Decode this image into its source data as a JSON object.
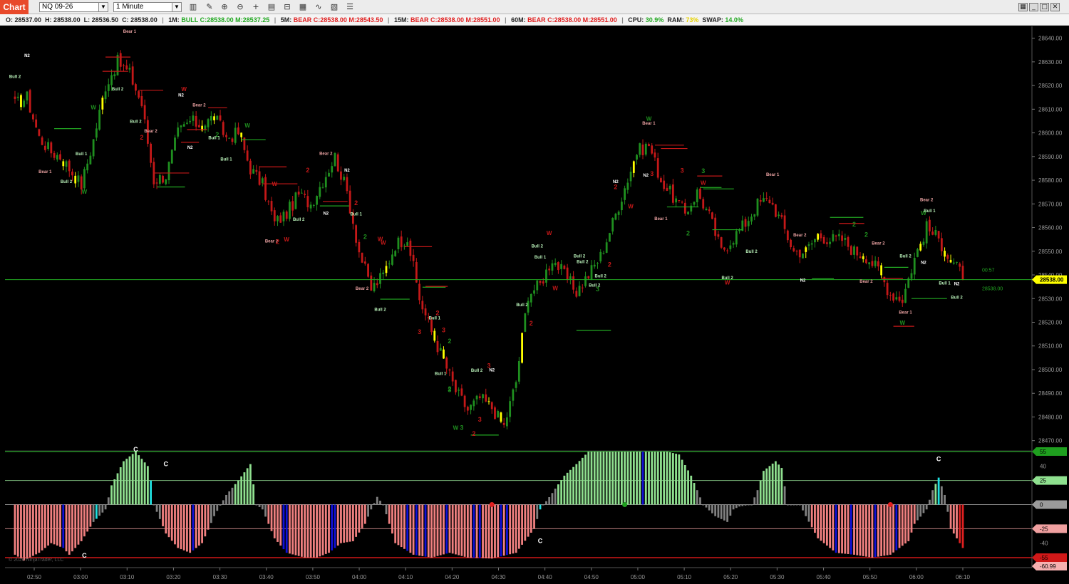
{
  "toolbar": {
    "tab_label": "Chart",
    "instrument": "NQ 09-26",
    "interval": "1 Minute"
  },
  "infobar": {
    "open": "O: 28537.00",
    "high": "H: 28538.00",
    "low": "L: 28536.50",
    "close": "C: 28538.00",
    "tf1_label": "1M:",
    "tf1_value": "BULL C:28538.00 M:28537.25",
    "tf5_label": "5M:",
    "tf5_value": "BEAR C:28538.00 M:28543.50",
    "tf15_label": "15M:",
    "tf15_value": "BEAR C:28538.00 M:28551.00",
    "tf60_label": "60M:",
    "tf60_value": "BEAR C:28538.00 M:28551.00",
    "cpu_label": "CPU:",
    "cpu_value": "30.9%",
    "ram_label": "RAM:",
    "ram_value": "73%",
    "swap_label": "SWAP:",
    "swap_value": "14.0%"
  },
  "colors": {
    "bull": "#1f8f1f",
    "bear": "#c41818",
    "doji": "#ffff00",
    "level_line": "#22a822",
    "osc_pos": "#8fe08f",
    "osc_neg": "#f08080",
    "osc_neutral": "#808080",
    "osc_blue": "#1010d8",
    "osc_cyan": "#20e0e0"
  },
  "chart_data": [
    {
      "type": "candlestick",
      "x_ticks": [
        "02:50",
        "03:00",
        "03:10",
        "03:20",
        "03:30",
        "03:40",
        "03:50",
        "04:00",
        "04:10",
        "04:20",
        "04:30",
        "04:40",
        "04:50",
        "05:00",
        "05:10",
        "05:20",
        "05:30",
        "05:40",
        "05:50",
        "06:00",
        "06:10"
      ],
      "y_ticks": [
        28470,
        28480,
        28490,
        28500,
        28510,
        28520,
        28530,
        28540,
        28550,
        28560,
        28570,
        28580,
        28590,
        28600,
        28610,
        28620,
        28630,
        28640
      ],
      "ylim": [
        28466,
        28645
      ],
      "last_price": "28538.00",
      "last_price_value": 28538,
      "timer": "00:57",
      "timer_price": "28538.00",
      "keypoints": [
        [
          0,
          28612
        ],
        [
          4,
          28615
        ],
        [
          8,
          28598
        ],
        [
          12,
          28592
        ],
        [
          15,
          28590
        ],
        [
          18,
          28585
        ],
        [
          22,
          28578
        ],
        [
          26,
          28597
        ],
        [
          30,
          28620
        ],
        [
          34,
          28630
        ],
        [
          38,
          28625
        ],
        [
          42,
          28612
        ],
        [
          46,
          28580
        ],
        [
          50,
          28582
        ],
        [
          54,
          28600
        ],
        [
          58,
          28605
        ],
        [
          62,
          28603
        ],
        [
          66,
          28607
        ],
        [
          70,
          28598
        ],
        [
          74,
          28600
        ],
        [
          78,
          28585
        ],
        [
          82,
          28578
        ],
        [
          86,
          28562
        ],
        [
          90,
          28566
        ],
        [
          94,
          28574
        ],
        [
          98,
          28570
        ],
        [
          102,
          28580
        ],
        [
          106,
          28590
        ],
        [
          110,
          28575
        ],
        [
          114,
          28550
        ],
        [
          118,
          28534
        ],
        [
          122,
          28540
        ],
        [
          126,
          28553
        ],
        [
          130,
          28556
        ],
        [
          134,
          28530
        ],
        [
          138,
          28516
        ],
        [
          142,
          28504
        ],
        [
          146,
          28491
        ],
        [
          150,
          28483
        ],
        [
          154,
          28488
        ],
        [
          158,
          28484
        ],
        [
          162,
          28476
        ],
        [
          166,
          28495
        ],
        [
          170,
          28532
        ],
        [
          174,
          28536
        ],
        [
          178,
          28547
        ],
        [
          182,
          28540
        ],
        [
          186,
          28533
        ],
        [
          190,
          28540
        ],
        [
          194,
          28548
        ],
        [
          198,
          28562
        ],
        [
          202,
          28577
        ],
        [
          206,
          28592
        ],
        [
          210,
          28595
        ],
        [
          214,
          28580
        ],
        [
          218,
          28573
        ],
        [
          222,
          28566
        ],
        [
          226,
          28575
        ],
        [
          230,
          28565
        ],
        [
          234,
          28550
        ],
        [
          238,
          28556
        ],
        [
          242,
          28562
        ],
        [
          246,
          28570
        ],
        [
          250,
          28572
        ],
        [
          254,
          28562
        ],
        [
          258,
          28550
        ],
        [
          262,
          28550
        ],
        [
          266,
          28557
        ],
        [
          270,
          28555
        ],
        [
          274,
          28555
        ],
        [
          278,
          28550
        ],
        [
          282,
          28548
        ],
        [
          286,
          28542
        ],
        [
          290,
          28532
        ],
        [
          294,
          28530
        ],
        [
          298,
          28547
        ],
        [
          302,
          28560
        ],
        [
          306,
          28555
        ],
        [
          310,
          28546
        ],
        [
          314,
          28540
        ]
      ]
    },
    {
      "type": "bar",
      "y_ticks": [
        55,
        40,
        25,
        0,
        -25,
        -40,
        -55,
        -60.99
      ],
      "ylim": [
        -58,
        58
      ],
      "levels": [
        55,
        25,
        0,
        -25,
        -55
      ],
      "last_value": "-60.99",
      "markers": [
        "C"
      ],
      "keypoints": [
        [
          0,
          -52
        ],
        [
          3,
          -58
        ],
        [
          8,
          -50
        ],
        [
          12,
          -40
        ],
        [
          16,
          -45
        ],
        [
          18,
          -52
        ],
        [
          22,
          -38
        ],
        [
          26,
          -18
        ],
        [
          30,
          -5
        ],
        [
          32,
          20
        ],
        [
          36,
          45
        ],
        [
          40,
          55
        ],
        [
          44,
          40
        ],
        [
          45,
          25
        ],
        [
          46,
          0
        ],
        [
          50,
          -30
        ],
        [
          54,
          -45
        ],
        [
          58,
          -50
        ],
        [
          62,
          -40
        ],
        [
          66,
          -12
        ],
        [
          70,
          10
        ],
        [
          74,
          25
        ],
        [
          78,
          42
        ],
        [
          80,
          0
        ],
        [
          82,
          -5
        ],
        [
          86,
          -35
        ],
        [
          90,
          -50
        ],
        [
          96,
          -55
        ],
        [
          100,
          -55
        ],
        [
          104,
          -50
        ],
        [
          108,
          -40
        ],
        [
          112,
          -38
        ],
        [
          116,
          -20
        ],
        [
          118,
          -5
        ],
        [
          120,
          8
        ],
        [
          122,
          0
        ],
        [
          126,
          -40
        ],
        [
          132,
          -52
        ],
        [
          138,
          -55
        ],
        [
          144,
          -50
        ],
        [
          150,
          -55
        ],
        [
          158,
          -56
        ],
        [
          166,
          -50
        ],
        [
          172,
          -25
        ],
        [
          174,
          -5
        ],
        [
          178,
          12
        ],
        [
          182,
          30
        ],
        [
          186,
          42
        ],
        [
          190,
          55
        ],
        [
          200,
          55
        ],
        [
          208,
          55
        ],
        [
          212,
          55
        ],
        [
          216,
          55
        ],
        [
          220,
          52
        ],
        [
          224,
          30
        ],
        [
          228,
          0
        ],
        [
          232,
          -12
        ],
        [
          236,
          -18
        ],
        [
          238,
          -5
        ],
        [
          240,
          -2
        ],
        [
          244,
          0
        ],
        [
          246,
          15
        ],
        [
          248,
          35
        ],
        [
          252,
          45
        ],
        [
          254,
          38
        ],
        [
          256,
          0
        ],
        [
          258,
          0
        ],
        [
          260,
          0
        ],
        [
          262,
          -12
        ],
        [
          266,
          -35
        ],
        [
          272,
          -50
        ],
        [
          278,
          -52
        ],
        [
          284,
          -55
        ],
        [
          290,
          -52
        ],
        [
          296,
          -38
        ],
        [
          298,
          -20
        ],
        [
          302,
          -5
        ],
        [
          304,
          15
        ],
        [
          306,
          28
        ],
        [
          308,
          10
        ],
        [
          310,
          -25
        ],
        [
          314,
          -45
        ],
        [
          318,
          -55
        ],
        [
          322,
          -60.99
        ]
      ]
    }
  ],
  "overlay_labels": {
    "bear1": "Bear 1",
    "bear2": "Bear 2",
    "bull1": "Bull 1",
    "bull2": "Bull 2",
    "n2": "N2",
    "three": "3",
    "two": "2",
    "w": "W",
    "c": "C"
  },
  "copyright": "© 2026 NinjaTrader, LLC"
}
